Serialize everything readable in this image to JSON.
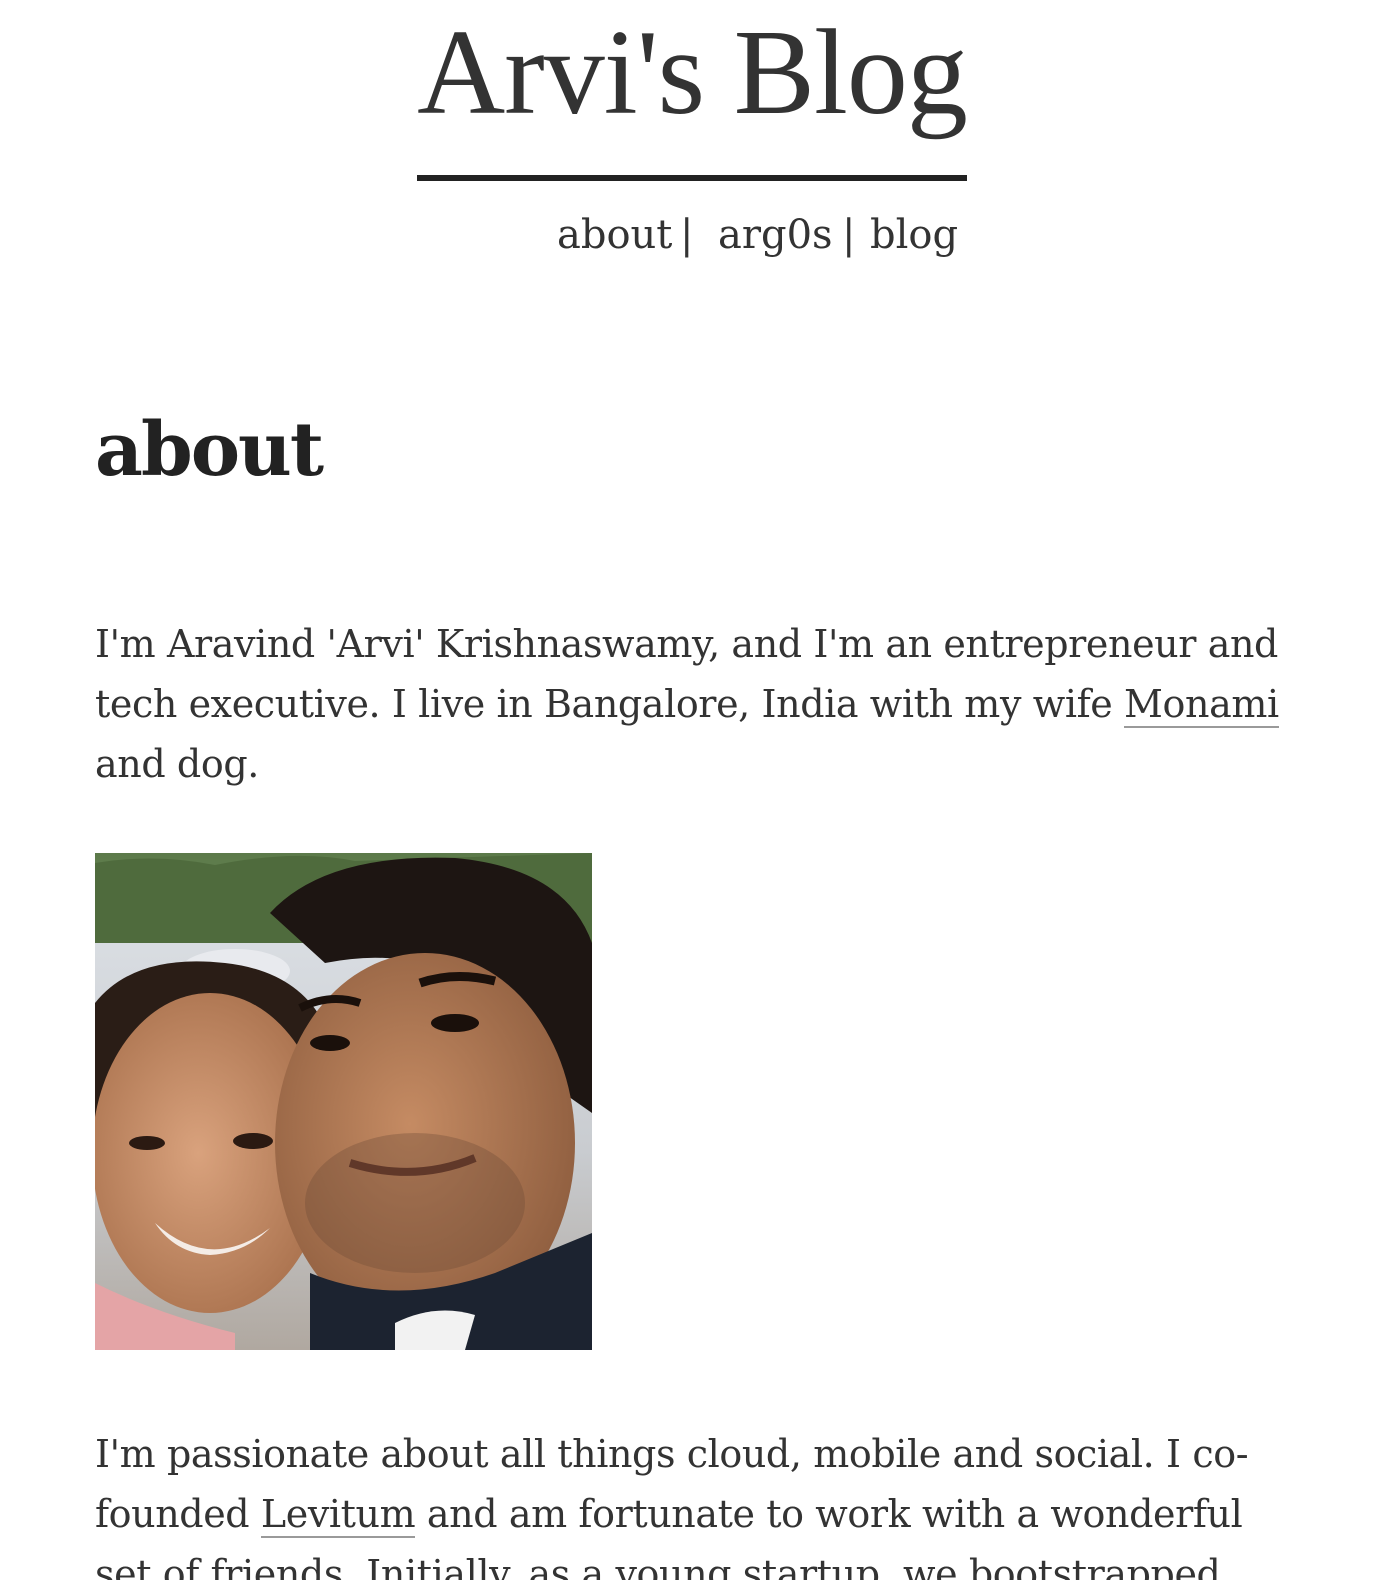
{
  "site": {
    "title": "Arvi's Blog"
  },
  "nav": {
    "items": [
      {
        "label": "about"
      },
      {
        "label": "arg0s"
      },
      {
        "label": "blog"
      }
    ],
    "separator": "|"
  },
  "page": {
    "heading": "about",
    "para1": {
      "line1": "I'm Aravind 'Arvi' Krishnaswamy, and I'm an entrepreneur and",
      "line2_text": "tech executive. I live in Bangalore, India with my wife ",
      "line2_link": "Monami",
      "line3": "and dog."
    },
    "photo": {
      "icon": "profile-photo"
    },
    "para2": {
      "line1": "I'm passionate about all things cloud, mobile and social. I co-",
      "line2_pre": "founded ",
      "line2_link": "Levitum",
      "line2_post": " and am fortunate to work with a wonderful",
      "line3": "set of friends. Initially, as a young startup, we bootstrapped"
    }
  },
  "colors": {
    "text": "#333333",
    "rule": "#222222",
    "link_underline": "#9a9a9a",
    "background": "#ffffff"
  }
}
